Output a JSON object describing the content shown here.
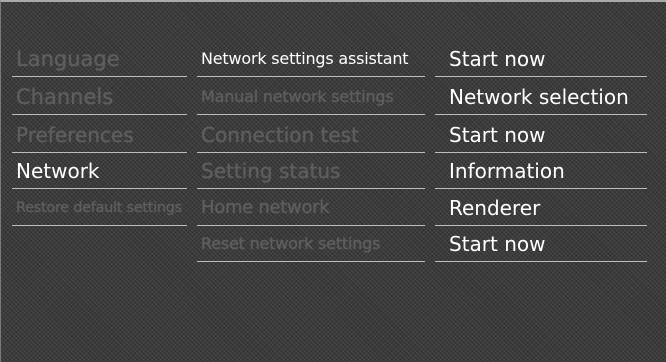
{
  "menu": {
    "categories": [
      {
        "label": "Language"
      },
      {
        "label": "Channels"
      },
      {
        "label": "Preferences"
      },
      {
        "label": "Network"
      },
      {
        "label": "Restore default settings"
      }
    ],
    "network_settings": [
      {
        "label": "Network settings assistant"
      },
      {
        "label": "Manual network settings"
      },
      {
        "label": "Connection test"
      },
      {
        "label": "Setting status"
      },
      {
        "label": "Home network"
      },
      {
        "label": "Reset network settings"
      }
    ],
    "actions": [
      {
        "label": "Start now"
      },
      {
        "label": "Network selection"
      },
      {
        "label": "Start now"
      },
      {
        "label": "Information"
      },
      {
        "label": "Renderer"
      },
      {
        "label": "Start now"
      }
    ],
    "selected_category": "Network"
  }
}
